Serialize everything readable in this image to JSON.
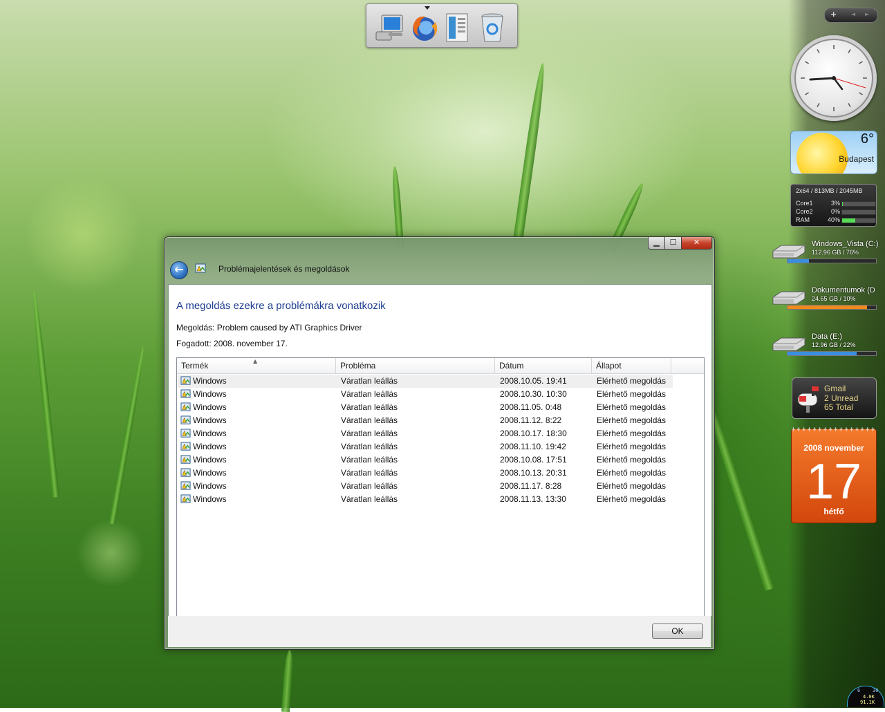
{
  "dock": {
    "items": [
      "computer-icon",
      "firefox-icon",
      "documents-icon",
      "recycle-bin-icon"
    ]
  },
  "sidebar": {
    "controls": {
      "add": "+",
      "prev": "◄",
      "next": "►"
    },
    "weather": {
      "temperature": "6°",
      "city": "Budapest"
    },
    "cpu": {
      "header": "2x64 / 813MB / 2045MB",
      "rows": [
        {
          "label": "Core1",
          "percent": "3%",
          "value": 0.03
        },
        {
          "label": "Core2",
          "percent": "0%",
          "value": 0.0
        },
        {
          "label": "RAM",
          "percent": "40%",
          "value": 0.4
        }
      ]
    },
    "drives": [
      {
        "name": "Windows_Vista (C:)",
        "info": "112.96 GB / 76%",
        "fraction": 0.24,
        "color": "#3a8ee0"
      },
      {
        "name": "Dokumentumok (D",
        "info": "24.65 GB / 10%",
        "fraction": 0.9,
        "color": "#f08a1a"
      },
      {
        "name": "Data (E:)",
        "info": "12.96 GB / 22%",
        "fraction": 0.78,
        "color": "#3a8ee0"
      }
    ],
    "gmail": {
      "title": "Gmail",
      "unread": "2 Unread",
      "total": "65 Total"
    },
    "calendar": {
      "month": "2008 november",
      "day": "17",
      "weekday": "hétfő"
    },
    "netmeter": {
      "a": "6",
      "b": "30",
      "c": "4.0K",
      "d": "91.1K"
    }
  },
  "window": {
    "title": "Problémajelentések és megoldások",
    "controls": {
      "minimize": "▁",
      "maximize": "☐",
      "close": "✕"
    },
    "heading": "A megoldás ezekre a problémákra vonatkozik",
    "solution": "Megoldás: Problem caused by ATI Graphics Driver",
    "received": "Fogadott: 2008. november 17.",
    "columns": [
      "Termék",
      "Probléma",
      "Dátum",
      "Állapot"
    ],
    "rows": [
      {
        "product": "Windows",
        "problem": "Váratlan leállás",
        "date": "2008.10.05. 19:41",
        "status": "Elérhető megoldás"
      },
      {
        "product": "Windows",
        "problem": "Váratlan leállás",
        "date": "2008.10.30. 10:30",
        "status": "Elérhető megoldás"
      },
      {
        "product": "Windows",
        "problem": "Váratlan leállás",
        "date": "2008.11.05. 0:48",
        "status": "Elérhető megoldás"
      },
      {
        "product": "Windows",
        "problem": "Váratlan leállás",
        "date": "2008.11.12. 8:22",
        "status": "Elérhető megoldás"
      },
      {
        "product": "Windows",
        "problem": "Váratlan leállás",
        "date": "2008.10.17. 18:30",
        "status": "Elérhető megoldás"
      },
      {
        "product": "Windows",
        "problem": "Váratlan leállás",
        "date": "2008.11.10. 19:42",
        "status": "Elérhető megoldás"
      },
      {
        "product": "Windows",
        "problem": "Váratlan leállás",
        "date": "2008.10.08. 17:51",
        "status": "Elérhető megoldás"
      },
      {
        "product": "Windows",
        "problem": "Váratlan leállás",
        "date": "2008.10.13. 20:31",
        "status": "Elérhető megoldás"
      },
      {
        "product": "Windows",
        "problem": "Váratlan leállás",
        "date": "2008.11.17. 8:28",
        "status": "Elérhető megoldás"
      },
      {
        "product": "Windows",
        "problem": "Váratlan leállás",
        "date": "2008.11.13. 13:30",
        "status": "Elérhető megoldás"
      }
    ],
    "ok_label": "OK"
  }
}
